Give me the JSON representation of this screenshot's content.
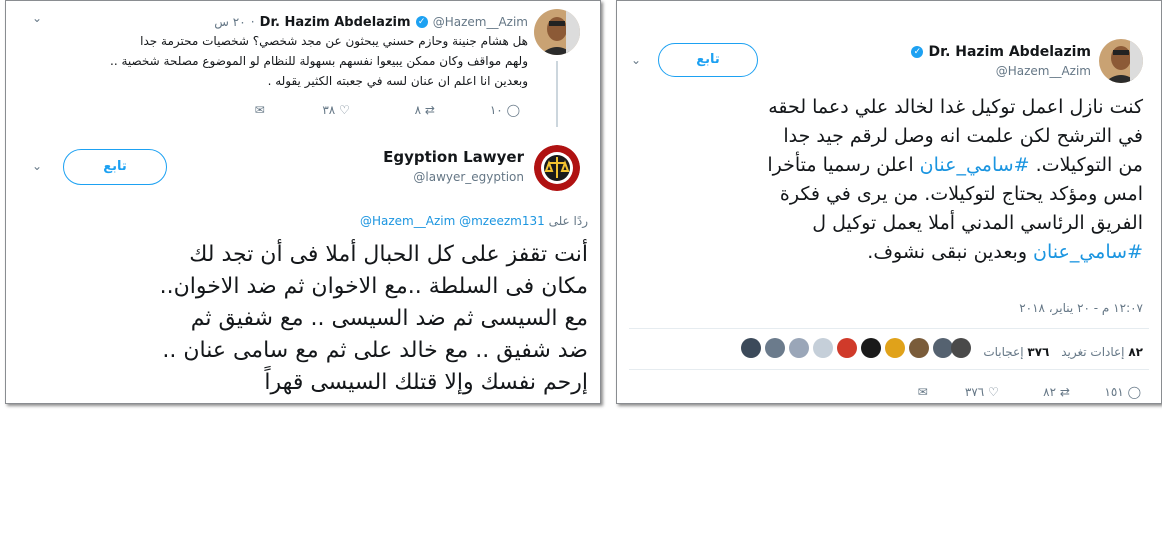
{
  "left": {
    "tweet1": {
      "name": "Dr. Hazim Abdelazim",
      "handle": "@Hazem__Azim",
      "time": "٢٠ س",
      "text_lines": [
        "هل هشام جنينة  وحازم حسني يبحثون عن مجد شخصي؟ شخصيات محترمة جدا",
        "ولهم مواقف وكان ممكن يبيعوا نفسهم بسهولة للنظام لو الموضوع مصلحة شخصية ..",
        "وبعدين انا اعلم ان عنان لسه في جعبته الكثير يقوله ."
      ],
      "replies": "١٠",
      "retweets": "٨",
      "likes": "٣٨"
    },
    "tweet2": {
      "name": "Egyption Lawyer",
      "handle": "@lawyer_egyption",
      "follow_label": "تابع",
      "reply_prefix": "ردًا على",
      "reply_to": "@Hazem__Azim @mzeezm131",
      "text_lines": [
        "أنت تقفز على كل الحبال أملا فى أن تجد لك",
        "مكان فى السلطة ..مع الاخوان ثم ضد الاخوان..",
        "مع السيسى ثم ضد السيسى .. مع شفيق ثم",
        "ضد شفيق .. مع خالد على ثم مع سامى عنان ..",
        "إرحم نفسك وإلا قتلك السيسى قهراً"
      ]
    }
  },
  "right": {
    "name": "Dr. Hazim Abdelazim",
    "handle": "@Hazem__Azim",
    "follow_label": "تابع",
    "text_lines": [
      "كنت نازل اعمل توكيل غدا لخالد علي دعما لحقه",
      "في الترشح لكن علمت انه وصل لرقم جيد جدا",
      "من التوكيلات. |#سامي_عنان| اعلن رسميا متأخرا",
      "امس ومؤكد يحتاج لتوكيلات. من يرى في فكرة",
      "الفريق الرئاسي المدني أملا يعمل توكيل ل",
      "|#سامي_عنان| وبعدين نبقى نشوف."
    ],
    "timestamp": "١٢:٠٧ م - ٢٠ يناير، ٢٠١٨",
    "retweets_count": "٨٢",
    "retweets_label": "إعادات تغريد",
    "likes_count": "٣٧٦",
    "likes_label": "إعجابات",
    "replies": "١٥١",
    "retweets": "٨٢",
    "likes": "٣٧٦",
    "colors": {
      "link": "#1b95e0",
      "verified": "#1da1f2",
      "muted": "#657786"
    }
  }
}
